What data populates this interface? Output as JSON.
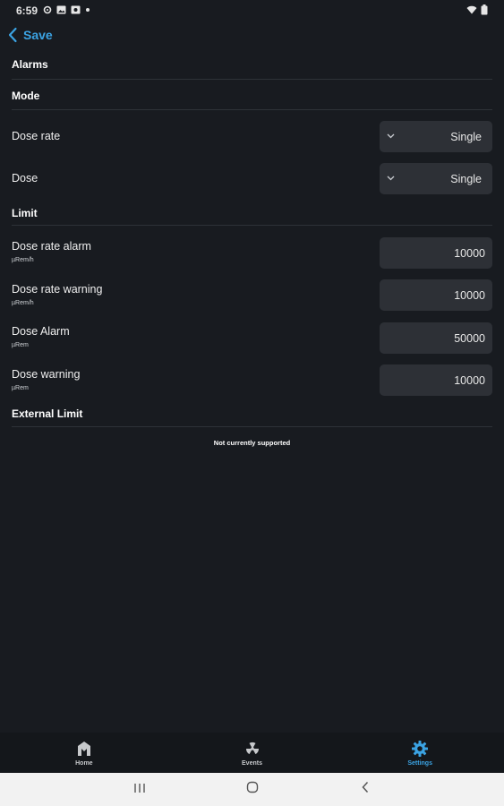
{
  "status_bar": {
    "time": "6:59",
    "icons": [
      "gear-notification-icon",
      "image-notification-icon",
      "photo-notification-icon",
      "dot-icon"
    ],
    "right_icons": [
      "wifi-icon",
      "battery-icon"
    ]
  },
  "header": {
    "back_label": "Save",
    "accent_color": "#3ba3e3"
  },
  "sections": {
    "alarms": "Alarms",
    "mode": "Mode",
    "limit": "Limit",
    "external_limit": "External Limit"
  },
  "mode_rows": [
    {
      "label": "Dose rate",
      "value": "Single"
    },
    {
      "label": "Dose",
      "value": "Single"
    }
  ],
  "limit_rows": [
    {
      "label": "Dose rate alarm",
      "unit": "µRem/h",
      "value": "10000"
    },
    {
      "label": "Dose rate warning",
      "unit": "µRem/h",
      "value": "10000"
    },
    {
      "label": "Dose Alarm",
      "unit": "µRem",
      "value": "50000"
    },
    {
      "label": "Dose warning",
      "unit": "µRem",
      "value": "10000"
    }
  ],
  "external_note": "Not currently supported",
  "bottom_nav": [
    {
      "label": "Home",
      "icon": "home-icon",
      "active": false
    },
    {
      "label": "Events",
      "icon": "radiation-icon",
      "active": false
    },
    {
      "label": "Settings",
      "icon": "gear-icon",
      "active": true
    }
  ],
  "system_nav": [
    "recents-icon",
    "home-circle-icon",
    "back-chevron-icon"
  ]
}
